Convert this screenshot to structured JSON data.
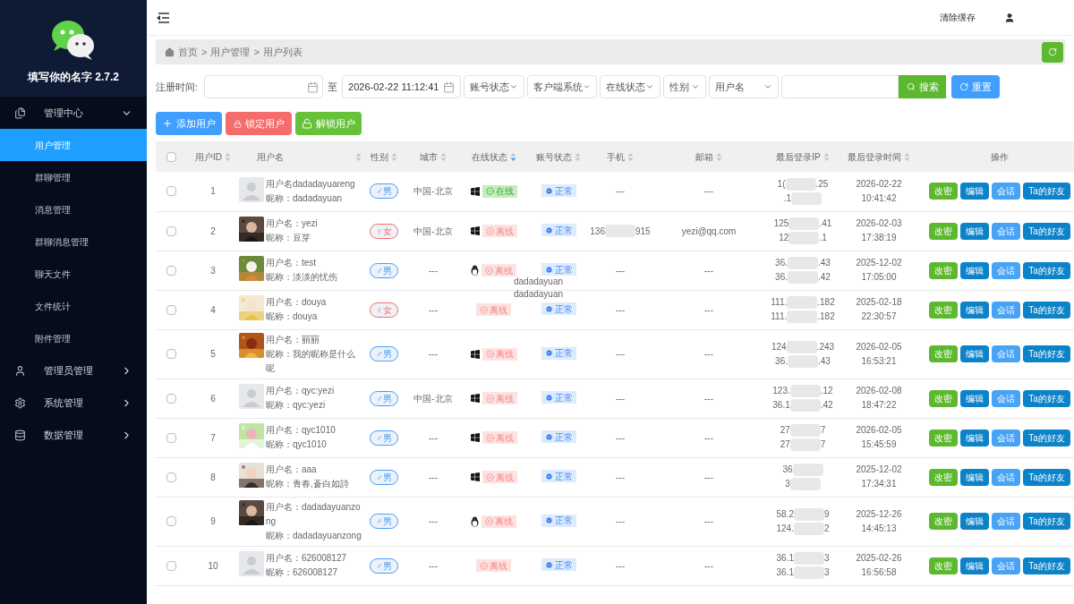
{
  "sidebar": {
    "app_name": "填写你的名字 2.7.2",
    "menu": [
      {
        "label": "管理中心",
        "expanded": true,
        "children": [
          {
            "label": "用户管理",
            "selected": true
          },
          {
            "label": "群聊管理",
            "selected": false
          },
          {
            "label": "消息管理",
            "selected": false
          },
          {
            "label": "群聊消息管理",
            "selected": false
          },
          {
            "label": "聊天文件",
            "selected": false
          },
          {
            "label": "文件统计",
            "selected": false
          },
          {
            "label": "附件管理",
            "selected": false
          }
        ]
      },
      {
        "label": "管理员管理",
        "expanded": false
      },
      {
        "label": "系统管理",
        "expanded": false
      },
      {
        "label": "数据管理",
        "expanded": false
      }
    ]
  },
  "topbar": {
    "clear_cache": "清除缓存"
  },
  "breadcrumb": [
    "首页",
    ">",
    "用户管理",
    ">",
    "用户列表"
  ],
  "filters": {
    "date_label": "注册时间:",
    "to_label": "至",
    "date_to": "2026-02-22 11:12:41",
    "selects": [
      "账号状态",
      "客户端系统",
      "在线状态",
      "性别",
      "用户名"
    ],
    "search_button": "搜索",
    "reset_button": "重置"
  },
  "actions": [
    {
      "label": "添加用户",
      "kind": "add"
    },
    {
      "label": "锁定用户",
      "kind": "lock"
    },
    {
      "label": "解锁用户",
      "kind": "unlock"
    }
  ],
  "table": {
    "select_all_checked": false,
    "columns": [
      {
        "label": "用户ID",
        "sortable": true,
        "sorted": false
      },
      {
        "label": "用户名",
        "sortable": true,
        "sorted": false
      },
      {
        "label": "性别",
        "sortable": true,
        "sorted": false
      },
      {
        "label": "城市",
        "sortable": true,
        "sorted": false
      },
      {
        "label": "在线状态",
        "sortable": true,
        "sorted": true
      },
      {
        "label": "账号状态",
        "sortable": true,
        "sorted": false
      },
      {
        "label": "手机",
        "sortable": true,
        "sorted": false
      },
      {
        "label": "邮箱",
        "sortable": true,
        "sorted": false
      },
      {
        "label": "最后登录IP",
        "sortable": true,
        "sorted": false
      },
      {
        "label": "最后登录时间",
        "sortable": true,
        "sorted": false
      },
      {
        "label": "操作",
        "sortable": false
      }
    ],
    "rows": [
      {
        "checked": false,
        "id": "1",
        "avatar": {
          "kind": "default"
        },
        "username": "用户名dadadayuareng",
        "nickname": "昵称：dadadayuan",
        "gender": {
          "symbol": "♂",
          "label": "男",
          "color": "#409eff"
        },
        "city": "中国-北京",
        "os": {
          "kind": "windows"
        },
        "online": true,
        "online_label": "在线",
        "account": "正常",
        "phone": [
          "---"
        ],
        "email": "---",
        "ip": [
          [
            "1(",
            ".25"
          ],
          [
            ".1"
          ]
        ],
        "date": "2026-02-22",
        "time": "10:41:42",
        "actions": [
          "改密",
          "编辑",
          "会话",
          "Ta的好友"
        ]
      },
      {
        "checked": false,
        "id": "2",
        "avatar": {
          "kind": "picture"
        },
        "username": "用户名：yezi",
        "nickname": "昵称：豆芽",
        "gender": {
          "symbol": "♀",
          "label": "女",
          "color": "#f56c6c"
        },
        "city": "中国-北京",
        "os": {
          "kind": "windows"
        },
        "online": false,
        "online_label": "离线",
        "account": "正常",
        "phone": [
          "136",
          "915"
        ],
        "email": "yezi@qq.com",
        "ip": [
          [
            "125",
            ".41"
          ],
          [
            "12",
            ".1"
          ]
        ],
        "date": "2026-02-03",
        "time": "17:38:19",
        "actions": [
          "改密",
          "编辑",
          "会话",
          "Ta的好友"
        ]
      },
      {
        "checked": false,
        "id": "3",
        "avatar": {
          "kind": "picture"
        },
        "username": "用户名：test",
        "nickname": "昵称：淡淡的忧伤",
        "gender": {
          "symbol": "♂",
          "label": "男",
          "color": "#409eff"
        },
        "city": "---",
        "os": {
          "kind": "linux"
        },
        "online": false,
        "online_label": "离线",
        "account": "正常",
        "phone": [
          "---"
        ],
        "email": "---",
        "ip": [
          [
            "36.",
            ".43"
          ],
          [
            "36.",
            ".42"
          ]
        ],
        "date": "2025-12-02",
        "time": "17:05:00",
        "actions": [
          "改密",
          "编辑",
          "会话",
          "Ta的好友"
        ]
      },
      {
        "checked": false,
        "id": "4",
        "avatar": {
          "kind": "picture"
        },
        "username": "用户名：douya",
        "nickname": "昵称：douya",
        "gender": {
          "symbol": "♀",
          "label": "女",
          "color": "#f56c6c"
        },
        "city": "---",
        "online": false,
        "online_label": "离线",
        "account": "正常",
        "phone": [
          "---"
        ],
        "email": "---",
        "ip": [
          [
            "111.",
            ".182"
          ],
          [
            "111.",
            ".182"
          ]
        ],
        "date": "2025-02-18",
        "time": "22:30:57",
        "actions": [
          "改密",
          "编辑",
          "会话",
          "Ta的好友"
        ]
      },
      {
        "checked": false,
        "id": "5",
        "avatar": {
          "kind": "picture"
        },
        "username": "用户名：丽丽",
        "nickname": "昵称：我的昵称是什么呢",
        "gender": {
          "symbol": "♂",
          "label": "男",
          "color": "#409eff"
        },
        "city": "---",
        "os": {
          "kind": "windows"
        },
        "online": false,
        "online_label": "离线",
        "account": "正常",
        "phone": [
          "---"
        ],
        "email": "---",
        "ip": [
          [
            "124",
            ".243"
          ],
          [
            "36.",
            ".43"
          ]
        ],
        "date": "2026-02-05",
        "time": "16:53:21",
        "actions": [
          "改密",
          "编辑",
          "会话",
          "Ta的好友"
        ]
      },
      {
        "checked": false,
        "id": "6",
        "avatar": {
          "kind": "default"
        },
        "username": "用户名：qyc:yezi",
        "nickname": "昵称：qyc:yezi",
        "gender": {
          "symbol": "♂",
          "label": "男",
          "color": "#409eff"
        },
        "city": "中国-北京",
        "os": {
          "kind": "windows"
        },
        "online": false,
        "online_label": "离线",
        "account": "正常",
        "phone": [
          "---"
        ],
        "email": "---",
        "ip": [
          [
            "123.",
            ".12"
          ],
          [
            "36.1",
            ".42"
          ]
        ],
        "date": "2026-02-08",
        "time": "18:47:22",
        "actions": [
          "改密",
          "编辑",
          "会话",
          "Ta的好友"
        ]
      },
      {
        "checked": false,
        "id": "7",
        "avatar": {
          "kind": "picture"
        },
        "username": "用户名：qyc1010",
        "nickname": "昵称：qyc1010",
        "gender": {
          "symbol": "♂",
          "label": "男",
          "color": "#409eff"
        },
        "city": "---",
        "os": {
          "kind": "windows"
        },
        "online": false,
        "online_label": "离线",
        "account": "正常",
        "phone": [
          "---"
        ],
        "email": "---",
        "ip": [
          [
            "27",
            "7"
          ],
          [
            "27",
            "7"
          ]
        ],
        "date": "2026-02-05",
        "time": "15:45:59",
        "actions": [
          "改密",
          "编辑",
          "会话",
          "Ta的好友"
        ]
      },
      {
        "checked": false,
        "id": "8",
        "avatar": {
          "kind": "picture"
        },
        "username": "用户名：aaa",
        "nickname": "昵称：青春,蒼白如詩",
        "gender": {
          "symbol": "♂",
          "label": "男",
          "color": "#409eff"
        },
        "city": "---",
        "os": {
          "kind": "windows"
        },
        "online": false,
        "online_label": "离线",
        "account": "正常",
        "phone": [
          "---"
        ],
        "email": "---",
        "ip": [
          [
            "36"
          ],
          [
            "3"
          ]
        ],
        "date": "2025-12-02",
        "time": "17:34:31",
        "actions": [
          "改密",
          "编辑",
          "会话",
          "Ta的好友"
        ]
      },
      {
        "checked": false,
        "id": "9",
        "avatar": {
          "kind": "picture"
        },
        "username": "用户名：dadadayuanzong",
        "nickname": "昵称：dadadayuanzong",
        "gender": {
          "symbol": "♂",
          "label": "男",
          "color": "#409eff"
        },
        "city": "---",
        "os": {
          "kind": "linux"
        },
        "online": false,
        "online_label": "离线",
        "account": "正常",
        "phone": [
          "---"
        ],
        "email": "---",
        "ip": [
          [
            "58.2",
            "9"
          ],
          [
            "124.",
            "2"
          ]
        ],
        "date": "2025-12-26",
        "time": "14:45:13",
        "actions": [
          "改密",
          "编辑",
          "会话",
          "Ta的好友"
        ]
      },
      {
        "checked": false,
        "id": "10",
        "avatar": {
          "kind": "default"
        },
        "username": "用户名：626008127",
        "nickname": "昵称：626008127",
        "gender": {
          "symbol": "♂",
          "label": "男",
          "color": "#409eff"
        },
        "city": "---",
        "online": false,
        "online_label": "离线",
        "account": "正常",
        "phone": [
          "---"
        ],
        "email": "---",
        "ip": [
          [
            "36.1",
            "3"
          ],
          [
            "36.1",
            "3"
          ]
        ],
        "date": "2025-02-26",
        "time": "16:56:58",
        "actions": [
          "改密",
          "编辑",
          "会话",
          "Ta的好友"
        ]
      }
    ]
  },
  "tooltip": [
    "dadadayuan",
    "dadadayuan"
  ]
}
